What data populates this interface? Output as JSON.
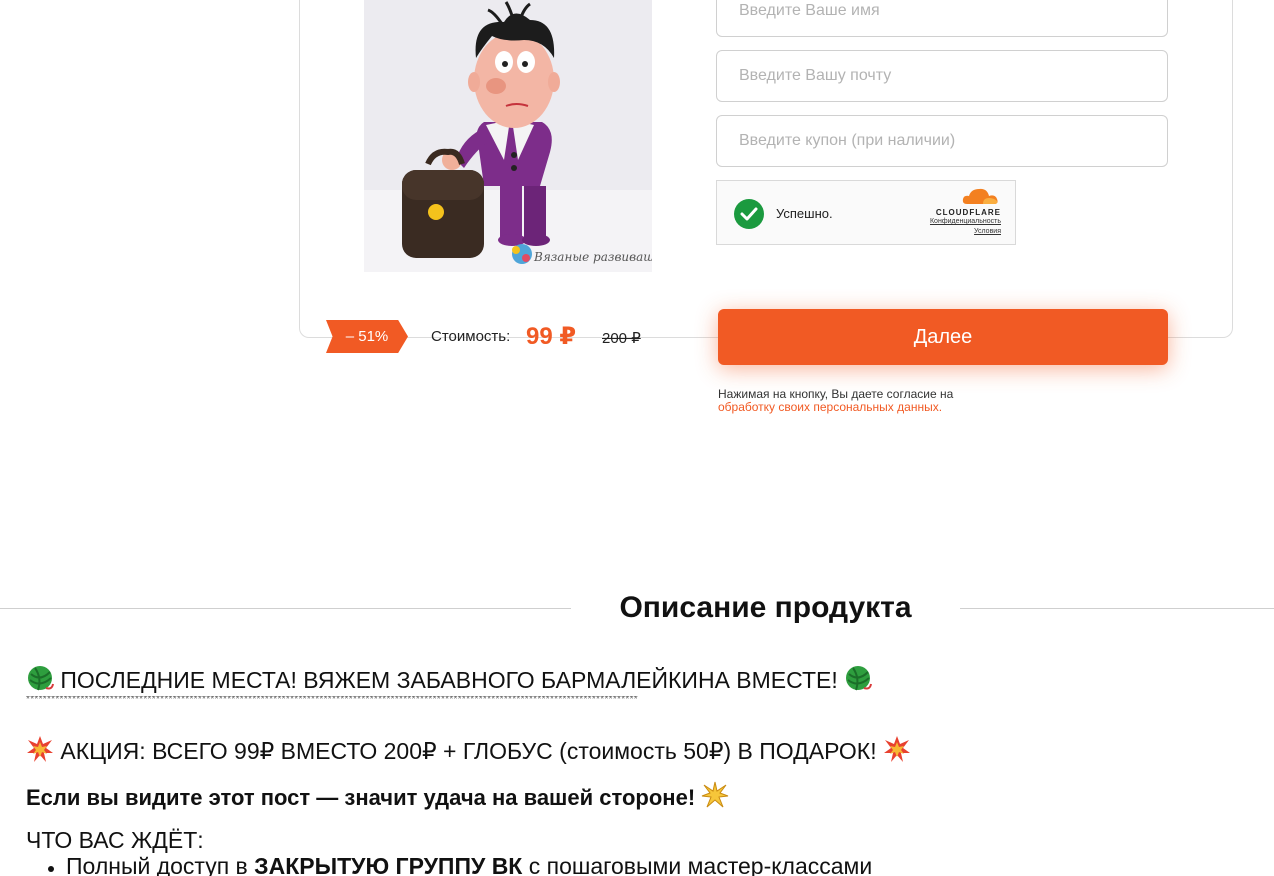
{
  "form": {
    "name_placeholder": "Введите Ваше имя",
    "email_placeholder": "Введите Вашу почту",
    "coupon_placeholder": "Введите купон (при наличии)"
  },
  "captcha": {
    "status": "Успешно.",
    "brand": "CLOUDFLARE",
    "privacy_link": "Конфиденциальность",
    "terms_link": "Условия"
  },
  "product": {
    "image_watermark": "Вязаные развивашки"
  },
  "price": {
    "discount": "– 51%",
    "label": "Стоимость:",
    "current": "99 ₽",
    "old": "200 ₽"
  },
  "cta": {
    "next_label": "Далее",
    "consent_text": "Нажимая на кнопку, Вы даете согласие на",
    "consent_link": "обработку своих персональных данных."
  },
  "description": {
    "heading": "Описание продукта",
    "line1": "ПОСЛЕДНИЕ МЕСТА! ВЯЖЕМ ЗАБАВНОГО БАРМАЛЕЙКИНА ВМЕСТЕ!",
    "stars": "**************************************************************************************************************************************************",
    "promo": "АКЦИЯ: ВСЕГО 99₽ ВМЕСТО 200₽ + ГЛОБУС (стоимость 50₽) В ПОДАРОК!",
    "luck": "Если вы видите этот пост — значит удача на вашей стороне!",
    "waiting": "ЧТО ВАС ЖДЁТ:",
    "bullet1_pre": "Полный доступ в ",
    "bullet1_bold": "ЗАКРЫТУЮ ГРУППУ ВК",
    "bullet1_post": " с пошаговыми мастер-классами"
  },
  "colors": {
    "accent": "#f15a24",
    "captcha_check": "#1b9a3f",
    "cloudflare_orange": "#f38020"
  },
  "icons": {
    "yarn": "yarn-ball-icon",
    "explosion": "collision-icon",
    "sparkle": "star-burst-icon",
    "check": "check-icon"
  }
}
